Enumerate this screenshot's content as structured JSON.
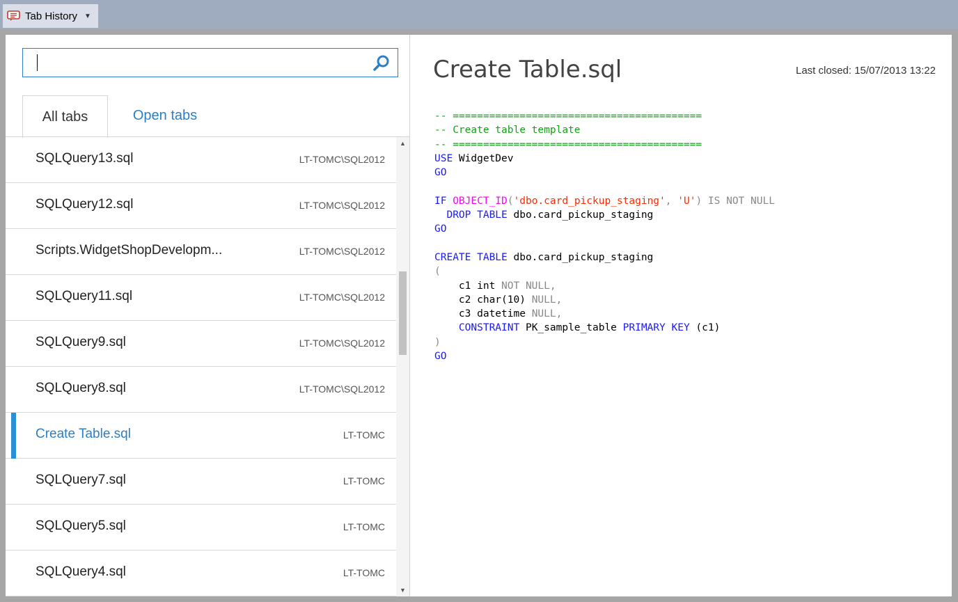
{
  "titlebar": {
    "tab_label": "Tab History"
  },
  "search": {
    "value": "",
    "placeholder": ""
  },
  "tabs": [
    {
      "label": "All tabs",
      "active": true
    },
    {
      "label": "Open tabs",
      "active": false
    }
  ],
  "list": [
    {
      "name": "SQLQuery13.sql",
      "server": "LT-TOMC\\SQL2012",
      "selected": false
    },
    {
      "name": "SQLQuery12.sql",
      "server": "LT-TOMC\\SQL2012",
      "selected": false
    },
    {
      "name": "Scripts.WidgetShopDevelopm...",
      "server": "LT-TOMC\\SQL2012",
      "selected": false
    },
    {
      "name": "SQLQuery11.sql",
      "server": "LT-TOMC\\SQL2012",
      "selected": false
    },
    {
      "name": "SQLQuery9.sql",
      "server": "LT-TOMC\\SQL2012",
      "selected": false
    },
    {
      "name": "SQLQuery8.sql",
      "server": "LT-TOMC\\SQL2012",
      "selected": false
    },
    {
      "name": "Create Table.sql",
      "server": "LT-TOMC",
      "selected": true
    },
    {
      "name": "SQLQuery7.sql",
      "server": "LT-TOMC",
      "selected": false
    },
    {
      "name": "SQLQuery5.sql",
      "server": "LT-TOMC",
      "selected": false
    },
    {
      "name": "SQLQuery4.sql",
      "server": "LT-TOMC",
      "selected": false
    }
  ],
  "detail": {
    "title": "Create Table.sql",
    "last_closed": "Last closed: 15/07/2013 13:22"
  },
  "code_lines": [
    [
      {
        "t": "-- =========================================",
        "c": "cm"
      }
    ],
    [
      {
        "t": "-- Create table template",
        "c": "cm"
      }
    ],
    [
      {
        "t": "-- =========================================",
        "c": "cm"
      }
    ],
    [
      {
        "t": "USE",
        "c": "kw"
      },
      {
        "t": " WidgetDev",
        "c": ""
      }
    ],
    [
      {
        "t": "GO",
        "c": "kw"
      }
    ],
    [
      {
        "t": "",
        "c": ""
      }
    ],
    [
      {
        "t": "IF",
        "c": "kw"
      },
      {
        "t": " ",
        "c": ""
      },
      {
        "t": "OBJECT_ID",
        "c": "fn"
      },
      {
        "t": "(",
        "c": "gr"
      },
      {
        "t": "'dbo.card_pickup_staging'",
        "c": "st"
      },
      {
        "t": ", ",
        "c": "gr"
      },
      {
        "t": "'U'",
        "c": "st"
      },
      {
        "t": ")",
        "c": "gr"
      },
      {
        "t": " IS NOT NULL",
        "c": "gr"
      }
    ],
    [
      {
        "t": "  DROP TABLE",
        "c": "kw"
      },
      {
        "t": " dbo.card_pickup_staging",
        "c": ""
      }
    ],
    [
      {
        "t": "GO",
        "c": "kw"
      }
    ],
    [
      {
        "t": "",
        "c": ""
      }
    ],
    [
      {
        "t": "CREATE TABLE",
        "c": "kw"
      },
      {
        "t": " dbo.card_pickup_staging",
        "c": ""
      }
    ],
    [
      {
        "t": "(",
        "c": "gr"
      }
    ],
    [
      {
        "t": "    c1 int ",
        "c": ""
      },
      {
        "t": "NOT NULL",
        "c": "gr"
      },
      {
        "t": ",",
        "c": "gr"
      }
    ],
    [
      {
        "t": "    c2 char(10) ",
        "c": ""
      },
      {
        "t": "NULL",
        "c": "gr"
      },
      {
        "t": ",",
        "c": "gr"
      }
    ],
    [
      {
        "t": "    c3 datetime ",
        "c": ""
      },
      {
        "t": "NULL",
        "c": "gr"
      },
      {
        "t": ",",
        "c": "gr"
      }
    ],
    [
      {
        "t": "    ",
        "c": ""
      },
      {
        "t": "CONSTRAINT",
        "c": "kw"
      },
      {
        "t": " PK_sample_table ",
        "c": ""
      },
      {
        "t": "PRIMARY KEY",
        "c": "kw"
      },
      {
        "t": " (c1)",
        "c": ""
      }
    ],
    [
      {
        "t": ")",
        "c": "gr"
      }
    ],
    [
      {
        "t": "GO",
        "c": "kw"
      }
    ]
  ],
  "colors": {
    "accent": "#2b7fc6",
    "selection_bar": "#2b8fd6",
    "titlebar": "#9fabbf"
  },
  "icons": {
    "titlebar_icon": "tab-history-icon",
    "search_icon": "search-icon"
  }
}
